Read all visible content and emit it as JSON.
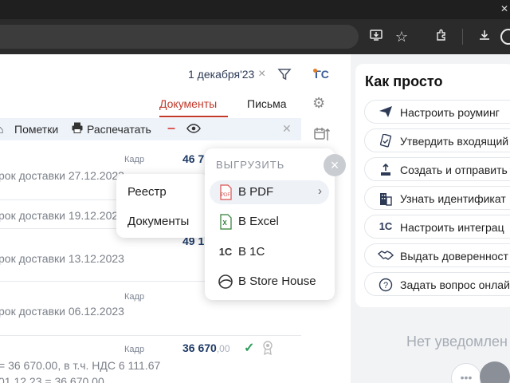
{
  "browser": {
    "icons": [
      "install-app-icon",
      "bookmark-star-icon",
      "extensions-icon",
      "downloads-icon"
    ]
  },
  "header": {
    "date": "1 декабря'23",
    "date_clear": "×",
    "user_initials": "ГС"
  },
  "tabs": {
    "documents": "Документы",
    "letters": "Письма"
  },
  "toolbar": {
    "marks": "Пометки",
    "print": "Распечатать",
    "minus": "–",
    "close": "✕"
  },
  "rows": [
    {
      "kadr": "Кадр",
      "amount_main": "46 7",
      "amount_cents": "",
      "text": "рок доставки 27.12.2023"
    },
    {
      "kadr": "",
      "amount_main": "",
      "amount_cents": "",
      "text": "рок доставки 19.12.2023"
    },
    {
      "kadr": "",
      "amount_main": "49 1",
      "amount_cents": "",
      "text": "рок доставки 13.12.2023"
    },
    {
      "kadr": "Кадр",
      "amount_main": "",
      "amount_cents": "",
      "text": "рок доставки 06.12.2023"
    },
    {
      "kadr": "Кадр",
      "amount_main": "36 670",
      "amount_cents": ",00",
      "text": "= 36 670.00, в т.ч. НДС 6 111.67",
      "text2": "01.12.23 = 36 670.00"
    }
  ],
  "menu_left": {
    "items": [
      "Реестр",
      "Документы"
    ]
  },
  "menu_export": {
    "header": "ВЫГРУЗИТЬ",
    "items": [
      {
        "label": "В PDF",
        "icon": "pdf-icon",
        "has_submenu": true,
        "color": "#d9534f"
      },
      {
        "label": "В Excel",
        "icon": "excel-icon",
        "has_submenu": false,
        "color": "#2e7d32"
      },
      {
        "label": "В 1С",
        "icon": "1c-icon",
        "has_submenu": false,
        "color": "#333333"
      },
      {
        "label": "В Store House",
        "icon": "store-house-icon",
        "has_submenu": false,
        "color": "#333333"
      }
    ],
    "close": "×"
  },
  "how_to": {
    "title": "Как просто",
    "actions": [
      {
        "label": "Настроить роуминг",
        "icon": "paper-plane-icon"
      },
      {
        "label": "Утвердить входящий",
        "icon": "document-check-icon"
      },
      {
        "label": "Создать и отправить",
        "icon": "upload-icon"
      },
      {
        "label": "Узнать идентификат",
        "icon": "building-icon"
      },
      {
        "label": "Настроить интеграц",
        "icon": "1c-icon"
      },
      {
        "label": "Выдать доверенност",
        "icon": "handshake-icon"
      },
      {
        "label": "Задать вопрос онлай",
        "icon": "question-icon"
      }
    ]
  },
  "notifications": {
    "empty_text": "Нет уведомлен"
  },
  "colors": {
    "accent": "#c0392b",
    "brand_blue": "#1f3b67",
    "check_green": "#2e9e5b"
  }
}
